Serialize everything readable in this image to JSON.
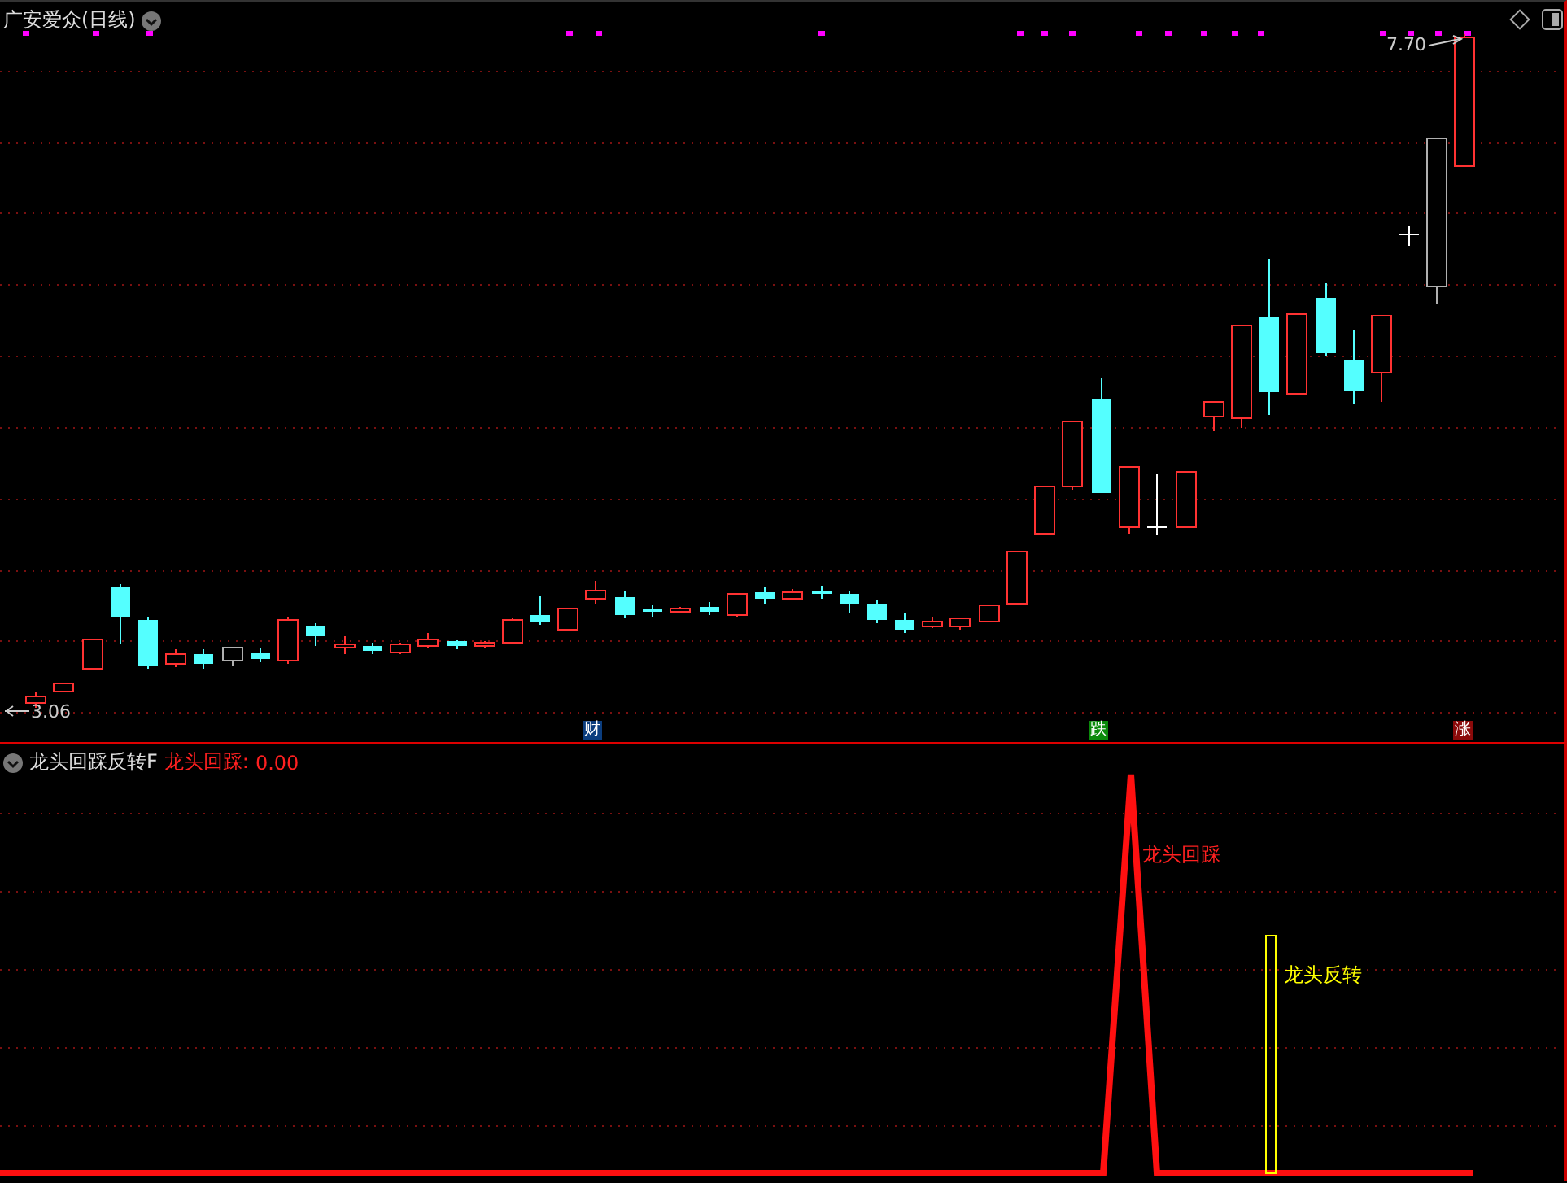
{
  "header": {
    "title": "广安爱众(日线)"
  },
  "price_chart": {
    "high_label": "7.70",
    "low_label": "3.06",
    "event_markers": [
      {
        "text": "财",
        "color": "#0b3d7e"
      },
      {
        "text": "跌",
        "color": "#0a8a0a"
      },
      {
        "text": "涨",
        "color": "#8b0a0a"
      }
    ]
  },
  "indicator": {
    "name": "龙头回踩反转F",
    "value_label": "龙头回踩:",
    "value": "0.00",
    "annotations": [
      {
        "kind": "pullback",
        "text": "龙头回踩"
      },
      {
        "kind": "reversal",
        "text": "龙头反转"
      }
    ]
  }
}
